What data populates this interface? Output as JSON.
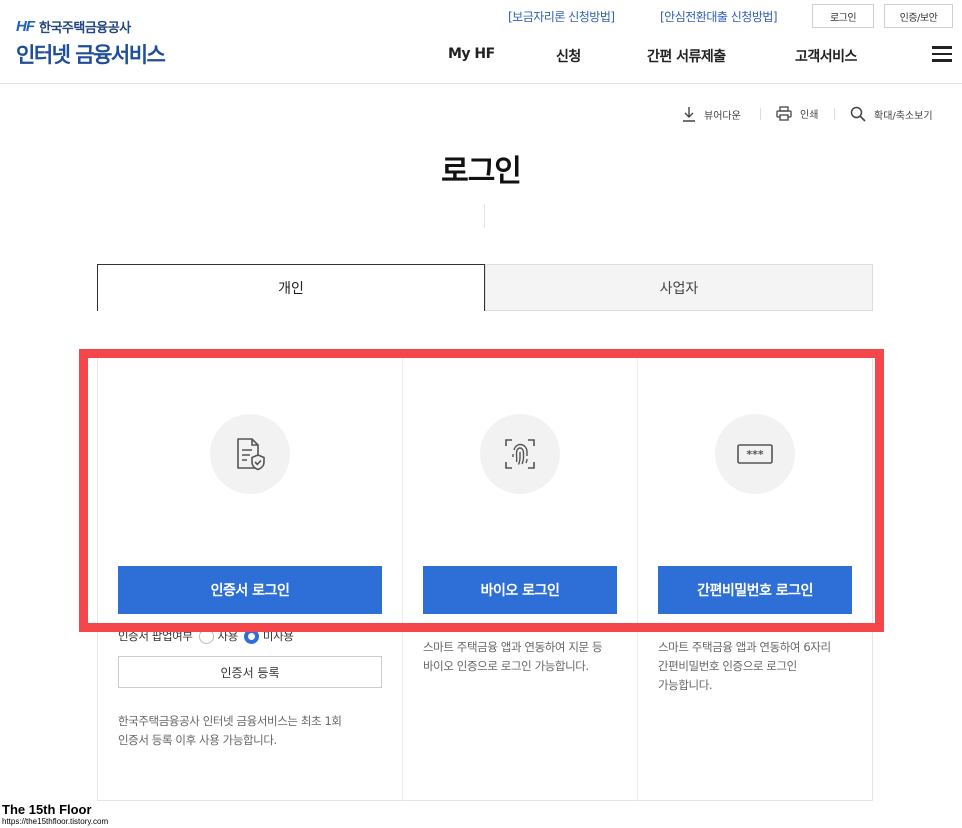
{
  "header": {
    "logo_mark": "HF",
    "logo_org": "한국주택금융공사",
    "logo_title": "인터넷 금융서비스",
    "util_links": [
      "[보금자리론 신청방법]",
      "[안심전환대출 신청방법]"
    ],
    "login_btn": "로그인",
    "cert_btn": "인증/보안",
    "nav": [
      "My HF",
      "신청",
      "간편 서류제출",
      "고객서비스"
    ]
  },
  "tools": {
    "viewer": "뷰어다운",
    "print": "인쇄",
    "zoom": "확대/축소보기"
  },
  "page_title": "로그인",
  "tabs": {
    "personal": "개인",
    "business": "사업자"
  },
  "methods": {
    "cert": {
      "button": "인증서 로그인",
      "popup_label": "인증서 팝업여부",
      "opt_use": "사용",
      "opt_nouse": "미사용",
      "register_btn": "인증서 등록",
      "desc1": "한국주택금융공사 인터넷 금융서비스는 최초 1회",
      "desc2": "인증서 등록 이후 사용 가능합니다."
    },
    "bio": {
      "button": "바이오 로그인",
      "desc1": "스마트 주택금융 앱과 연동하여 지문 등",
      "desc2": "바이오 인증으로 로그인 가능합니다."
    },
    "pin": {
      "icon_text": "***",
      "button": "간편비밀번호 로그인",
      "desc1": "스마트 주택금융 앱과 연동하여 6자리",
      "desc2": "간편비밀번호 인증으로 로그인",
      "desc3": "가능합니다."
    }
  },
  "watermark": {
    "title": "The 15th Floor",
    "url": "https://the15thfloor.tistory.com"
  },
  "colors": {
    "primary": "#2d6fd6",
    "highlight": "#f5474b",
    "brand": "#1f4f9a"
  }
}
